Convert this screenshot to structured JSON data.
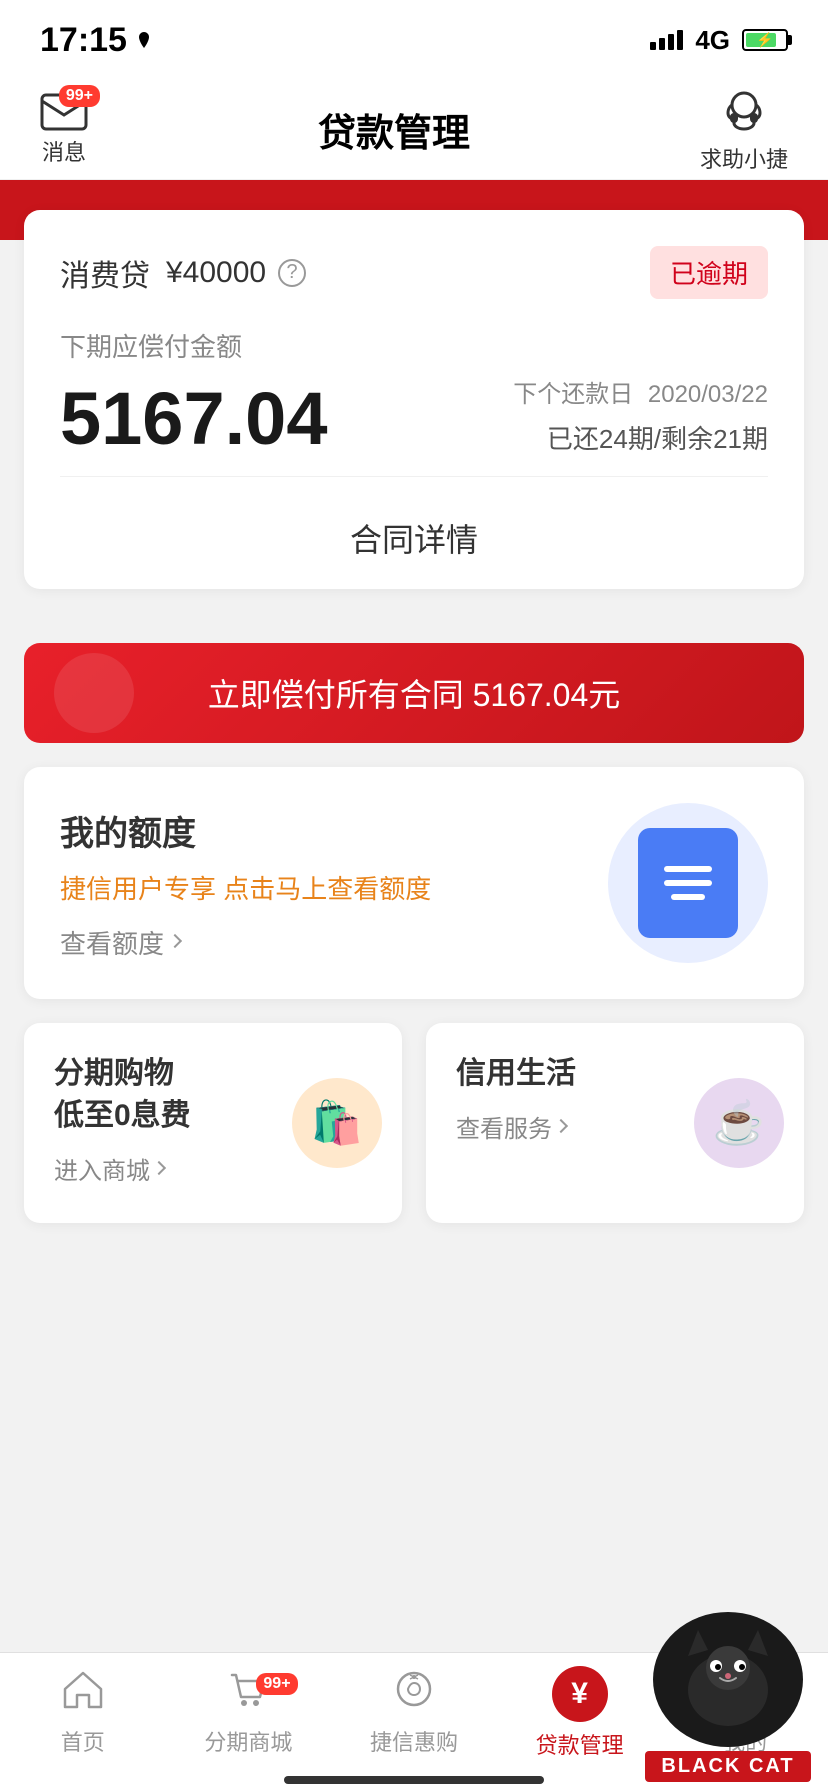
{
  "statusBar": {
    "time": "17:15",
    "signal": "4G"
  },
  "navBar": {
    "leftIcon": "mail-icon",
    "leftLabel": "消息",
    "leftBadge": "99+",
    "title": "贷款管理",
    "rightIcon": "headset-icon",
    "rightLabel": "求助小捷"
  },
  "loanCard": {
    "loanType": "消费贷",
    "loanAmount": "¥40000",
    "statusBadge": "已逾期",
    "nextPaymentLabel": "下期应偿付金额",
    "paymentAmount": "5167.04",
    "nextDateLabel": "下个还款日",
    "nextDate": "2020/03/22",
    "periodsInfo": "已还24期/剩余21期",
    "contractDetail": "合同详情"
  },
  "payButton": {
    "label": "立即偿付所有合同 5167.04元"
  },
  "creditCard": {
    "title": "我的额度",
    "subtitle": "捷信用户专享 点击马上查看额度",
    "linkText": "查看额度",
    "iconName": "clipboard-icon"
  },
  "shoppingCard": {
    "title": "分期购物\n低至0息费",
    "linkText": "进入商城",
    "iconName": "shopping-bag-icon"
  },
  "creditLifeCard": {
    "title": "信用生活",
    "linkText": "查看服务",
    "iconName": "coffee-icon"
  },
  "bottomNav": {
    "items": [
      {
        "id": "home",
        "label": "首页",
        "icon": "home-icon",
        "active": false
      },
      {
        "id": "mall",
        "label": "分期商城",
        "icon": "cart-icon",
        "active": false,
        "badge": "99+"
      },
      {
        "id": "benefits",
        "label": "捷信惠购",
        "icon": "coupon-icon",
        "active": false
      },
      {
        "id": "loans",
        "label": "贷款管理",
        "icon": "yuan-icon",
        "active": true
      },
      {
        "id": "mine",
        "label": "我的",
        "icon": "user-icon",
        "active": false
      }
    ]
  },
  "watermark": {
    "text": "BLACK CAT"
  }
}
